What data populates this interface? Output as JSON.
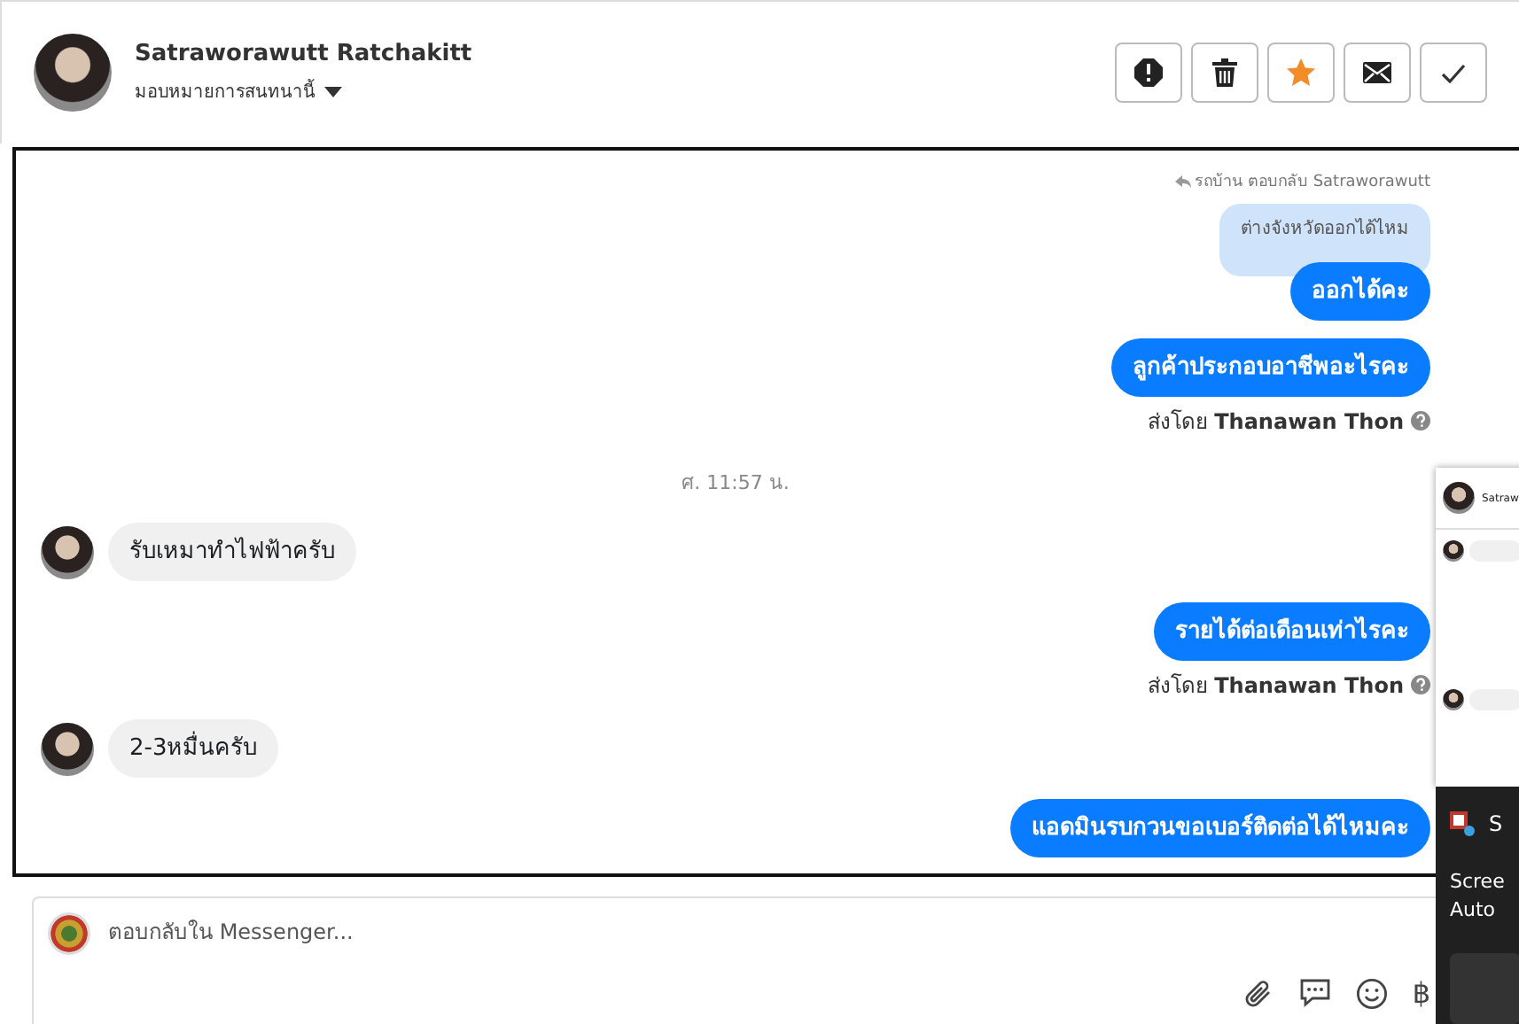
{
  "header": {
    "name": "Satraworawutt Ratchakitt",
    "assign_label": "มอบหมายการสนทนานี้",
    "actions": [
      {
        "kind": "alert"
      },
      {
        "kind": "delete"
      },
      {
        "kind": "star"
      },
      {
        "kind": "mail"
      },
      {
        "kind": "done"
      }
    ]
  },
  "messages": [
    {
      "kind": "reply-note",
      "text": "รถบ้าน ตอบกลับ Satraworawutt"
    },
    {
      "kind": "quote",
      "text": "ต่างจังหวัดออกได้ไหม"
    },
    {
      "kind": "outgoing",
      "text": "ออกได้คะ"
    },
    {
      "kind": "outgoing",
      "text": "ลูกค้าประกอบอาชีพอะไรคะ"
    },
    {
      "kind": "sent-by",
      "text": "ส่งโดย **Thanawan Thon**"
    },
    {
      "kind": "time",
      "text": "ศ. 11:57 น."
    },
    {
      "kind": "incoming",
      "text": "รับเหมาทำไฟฟ้าครับ"
    },
    {
      "kind": "outgoing",
      "text": "รายได้ต่อเดือนเท่าไรคะ"
    },
    {
      "kind": "sent-by",
      "text": "ส่งโดย **Thanawan Thon**"
    },
    {
      "kind": "incoming",
      "text": "2-3หมื่นครับ"
    },
    {
      "kind": "outgoing",
      "text": "แอดมินรบกวนขอเบอร์ติดต่อได้ไหมคะ"
    }
  ],
  "composer": {
    "placeholder": "ตอบกลับใน Messenger...",
    "currency_symbol": "฿"
  },
  "popup": {
    "chat_name": "Satraw",
    "notice_title": "S",
    "notice_lines": [
      "Scree",
      "Auto"
    ]
  }
}
